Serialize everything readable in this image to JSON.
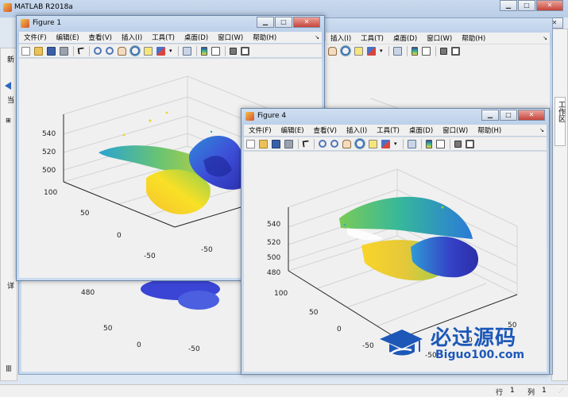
{
  "main_window": {
    "title": "MATLAB R2018a",
    "left_strip_labels": [
      "新",
      "当",
      "详"
    ],
    "right_strip_label": "工作区",
    "status": {
      "row_label": "行",
      "row_value": "1",
      "col_label": "列",
      "col_value": "1"
    }
  },
  "menu_items": [
    "文件(F)",
    "编辑(E)",
    "查看(V)",
    "插入(I)",
    "工具(T)",
    "桌面(D)",
    "窗口(W)",
    "帮助(H)"
  ],
  "toolbar_icons": [
    "new-figure-icon",
    "open-file-icon",
    "save-icon",
    "print-icon",
    "select-cursor-icon",
    "zoom-in-icon",
    "zoom-out-icon",
    "pan-icon",
    "rotate-3d-icon",
    "data-cursor-icon",
    "brush-icon",
    "link-plot-icon",
    "insert-colorbar-icon",
    "insert-legend-icon",
    "hide-plot-tools-icon",
    "show-plot-tools-icon"
  ],
  "figure1": {
    "title": "Figure 1",
    "z_ticks": [
      "540",
      "520",
      "500"
    ],
    "y_ticks": [
      "100",
      "50",
      "0",
      "-50"
    ],
    "x_ticks": [
      "-50",
      "0"
    ]
  },
  "figure4": {
    "title": "Figure 4",
    "z_ticks": [
      "540",
      "520",
      "500",
      "480"
    ],
    "y_ticks": [
      "100",
      "50",
      "0",
      "-50"
    ],
    "x_ticks": [
      "-50",
      "0",
      "50"
    ]
  },
  "background_figure": {
    "z_ticks": [
      "480"
    ],
    "y_ticks": [
      "50",
      "0"
    ],
    "x_ticks": [
      "-50",
      "0",
      "50"
    ]
  },
  "watermark": {
    "chinese": "必过源码",
    "english": "Biguo100.com"
  },
  "colors": {
    "window_frame": "#6c86a8",
    "plot_bg": "#f0f0f0",
    "watermark_blue": "#1d58b8",
    "parula_low": "#3e26a8",
    "parula_mid": "#21bfa0",
    "parula_high": "#f9e026"
  }
}
